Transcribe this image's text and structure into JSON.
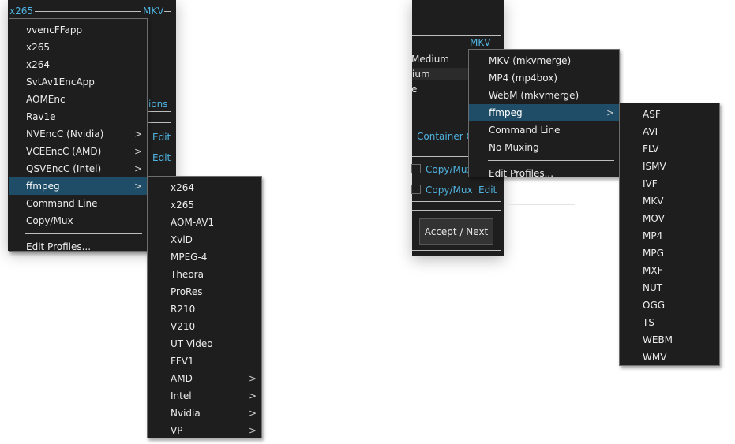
{
  "left": {
    "group_title": "x265",
    "group_right": "MKV",
    "behind_text_ions": "ions",
    "edit_labels": [
      "Edit",
      "Edit"
    ],
    "encoder_menu": {
      "items": [
        {
          "label": "vvencFFapp"
        },
        {
          "label": "x265"
        },
        {
          "label": "x264"
        },
        {
          "label": "SvtAv1EncApp"
        },
        {
          "label": "AOMEnc"
        },
        {
          "label": "Rav1e"
        },
        {
          "label": "NVEncC (Nvidia)",
          "sub": ">"
        },
        {
          "label": "VCEEncC (AMD)",
          "sub": ">"
        },
        {
          "label": "QSVEncC (Intel)",
          "sub": ">"
        },
        {
          "label": "ffmpeg",
          "sub": ">"
        },
        {
          "label": "Command Line"
        },
        {
          "label": "Copy/Mux"
        },
        {
          "label": "Edit Profiles..."
        }
      ]
    },
    "ffmpeg_submenu": {
      "items": [
        {
          "label": "x264"
        },
        {
          "label": "x265"
        },
        {
          "label": "AOM-AV1"
        },
        {
          "label": "XviD"
        },
        {
          "label": "MPEG-4"
        },
        {
          "label": "Theora"
        },
        {
          "label": "ProRes"
        },
        {
          "label": "R210"
        },
        {
          "label": "V210"
        },
        {
          "label": "UT Video"
        },
        {
          "label": "FFV1"
        },
        {
          "label": "AMD",
          "sub": ">"
        },
        {
          "label": "Intel",
          "sub": ">"
        },
        {
          "label": "Nvidia",
          "sub": ">"
        },
        {
          "label": "VP",
          "sub": ">"
        }
      ]
    }
  },
  "right": {
    "group_right": "MKV",
    "behind_medium": "Medium",
    "behind_ium": "ium",
    "behind_e": "e",
    "container_link": "Container O",
    "copymux_labels": [
      "Copy/Mux",
      "Copy/Mux"
    ],
    "edit_label": "Edit",
    "accept_button": "Accept / Next",
    "muxer_menu": {
      "items": [
        {
          "label": "MKV (mkvmerge)"
        },
        {
          "label": "MP4 (mp4box)"
        },
        {
          "label": "WebM (mkvmerge)"
        },
        {
          "label": "ffmpeg",
          "sub": ">"
        },
        {
          "label": "Command Line"
        },
        {
          "label": "No Muxing"
        },
        {
          "label": "Edit Profiles..."
        }
      ]
    },
    "ffmpeg_formats": {
      "items": [
        "ASF",
        "AVI",
        "FLV",
        "ISMV",
        "IVF",
        "MKV",
        "MOV",
        "MP4",
        "MPG",
        "MXF",
        "NUT",
        "OGG",
        "TS",
        "WEBM",
        "WMV"
      ]
    }
  }
}
